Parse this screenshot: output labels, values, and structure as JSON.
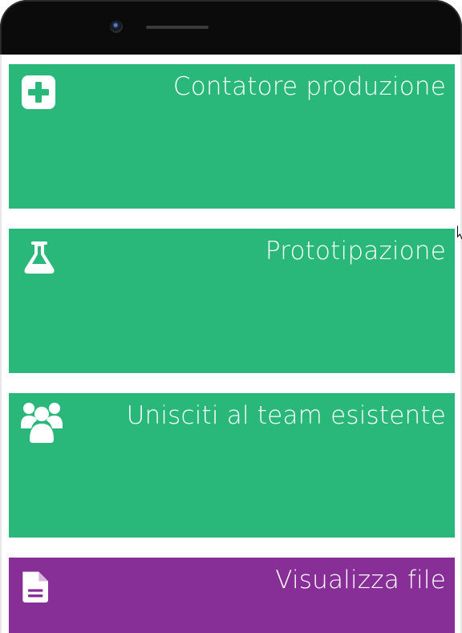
{
  "colors": {
    "tile_green": "#29b879",
    "tile_purple": "#872f97",
    "text": "#ffffff"
  },
  "tiles": [
    {
      "label": "Contatore produzione",
      "icon": "plus-square-icon",
      "color": "#29b879"
    },
    {
      "label": "Prototipazione",
      "icon": "flask-icon",
      "color": "#29b879"
    },
    {
      "label": "Unisciti al team esistente",
      "icon": "users-group-icon",
      "color": "#29b879"
    },
    {
      "label": "Visualizza file",
      "icon": "file-text-icon",
      "color": "#872f97"
    }
  ]
}
